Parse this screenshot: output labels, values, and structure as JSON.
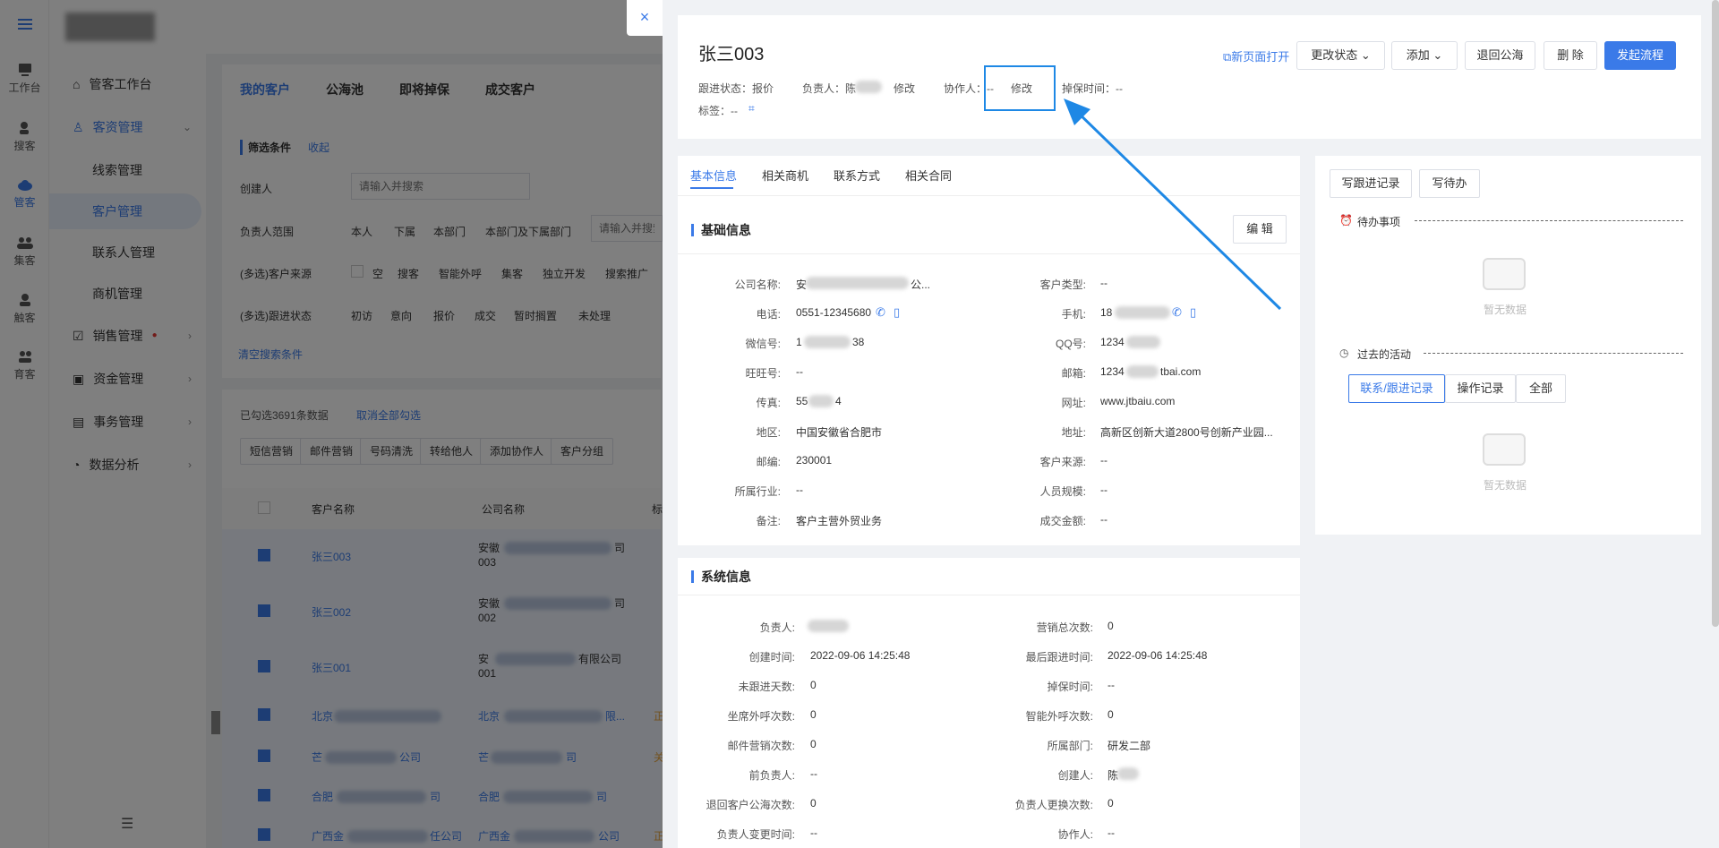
{
  "rail": [
    {
      "label": "工作台",
      "icon": "desk-icon"
    },
    {
      "label": "搜客",
      "icon": "search-user-icon"
    },
    {
      "label": "管客",
      "icon": "cloud-icon"
    },
    {
      "label": "集客",
      "icon": "group-icon"
    },
    {
      "label": "触客",
      "icon": "contact-icon"
    },
    {
      "label": "育客",
      "icon": "nurture-icon"
    }
  ],
  "sidenav": {
    "workbench": "管客工作台",
    "customer_mgmt": "客资管理",
    "leads": "线索管理",
    "customers": "客户管理",
    "contacts": "联系人管理",
    "opportunities": "商机管理",
    "sales": "销售管理",
    "funds": "资金管理",
    "affairs": "事务管理",
    "analytics": "数据分析"
  },
  "main": {
    "tabs": [
      "我的客户",
      "公海池",
      "即将掉保",
      "成交客户"
    ],
    "filter_title": "筛选条件",
    "collapse": "收起",
    "creator_label": "创建人",
    "creator_placeholder": "请输入并搜索",
    "owner_range_label": "负责人范围",
    "owner_range_opts": [
      "本人",
      "下属",
      "本部门",
      "本部门及下属部门"
    ],
    "owner_search_placeholder": "请输入并搜索",
    "source_label": "(多选)客户来源",
    "source_opts": [
      "空",
      "搜客",
      "智能外呼",
      "集客",
      "独立开发",
      "搜索推广"
    ],
    "status_label": "(多选)跟进状态",
    "status_opts": [
      "初访",
      "意向",
      "报价",
      "成交",
      "暂时搁置",
      "未处理"
    ],
    "clear": "清空搜索条件",
    "selected_info": "已勾选3691条数据",
    "cancel_all": "取消全部勾选",
    "actions": [
      "短信营销",
      "邮件营销",
      "号码清洗",
      "转给他人",
      "添加协作人",
      "客户分组"
    ],
    "col_name": "客户名称",
    "col_company": "公司名称",
    "col_extra": "标",
    "rows": [
      {
        "name": "张三003",
        "company_a": "安徽",
        "company_b": "司",
        "company_c": "003"
      },
      {
        "name": "张三002",
        "company_a": "安徽",
        "company_b": "司",
        "company_c": "002"
      },
      {
        "name": "张三001",
        "company_a": "安",
        "company_b": "有限公司",
        "company_c": "001"
      },
      {
        "name": "北京",
        "company_a": "北京",
        "company_b": "限..."
      },
      {
        "name": "芒",
        "company_a": "芒",
        "company_b": "司",
        "name_suffix": "公司"
      },
      {
        "name": "合肥",
        "company_a": "合肥",
        "company_b": "司",
        "name_suffix": "司"
      },
      {
        "name": "广西金",
        "company_a": "广西金",
        "company_b": "公司",
        "name_suffix": "任公司"
      }
    ],
    "row_marks": [
      "正",
      "关",
      "正"
    ]
  },
  "drawer": {
    "close": "×",
    "title": "张三003",
    "follow_status_label": "跟进状态：",
    "follow_status": "报价",
    "owner_label": "负责人：",
    "owner_name": "陈",
    "edit1": "修改",
    "collaborator_label": "协作人：",
    "collaborator_value": "--",
    "edit2": "修改",
    "drop_time_label": "掉保时间：",
    "drop_time": "--",
    "tags_label": "标签：",
    "tags_value": "--",
    "open_new": "新页面打开",
    "btn_change_status": "更改状态",
    "btn_add": "添加",
    "btn_return": "退回公海",
    "btn_delete": "删 除",
    "btn_process": "发起流程",
    "tabs": [
      "基本信息",
      "相关商机",
      "联系方式",
      "相关合同"
    ],
    "basic_title": "基础信息",
    "edit_btn": "编 辑",
    "fields_left": [
      {
        "label": "公司名称:",
        "value": "安",
        "suffix": "公..."
      },
      {
        "label": "电话:",
        "value": "0551-12345680"
      },
      {
        "label": "微信号:",
        "value": "1",
        "suffix": "38"
      },
      {
        "label": "旺旺号:",
        "value": "--"
      },
      {
        "label": "传真:",
        "value": "55",
        "suffix": "4"
      },
      {
        "label": "地区:",
        "value": "中国安徽省合肥市"
      },
      {
        "label": "邮编:",
        "value": "230001"
      },
      {
        "label": "所属行业:",
        "value": "--"
      },
      {
        "label": "备注:",
        "value": "客户主营外贸业务"
      }
    ],
    "fields_right": [
      {
        "label": "客户类型:",
        "value": "--"
      },
      {
        "label": "手机:",
        "value": "18"
      },
      {
        "label": "QQ号:",
        "value": "1234"
      },
      {
        "label": "邮箱:",
        "value": "1234",
        "suffix": "tbai.com"
      },
      {
        "label": "网址:",
        "value": "www.jtbaiu.com"
      },
      {
        "label": "地址:",
        "value": "高新区创新大道2800号创新产业园..."
      },
      {
        "label": "客户来源:",
        "value": "--"
      },
      {
        "label": "人员规模:",
        "value": "--"
      },
      {
        "label": "成交金额:",
        "value": "--"
      }
    ],
    "system_title": "系统信息",
    "sys_left": [
      {
        "label": "负责人:",
        "value": ""
      },
      {
        "label": "创建时间:",
        "value": "2022-09-06 14:25:48"
      },
      {
        "label": "未跟进天数:",
        "value": "0"
      },
      {
        "label": "坐席外呼次数:",
        "value": "0"
      },
      {
        "label": "邮件营销次数:",
        "value": "0"
      },
      {
        "label": "前负责人:",
        "value": "--"
      },
      {
        "label": "退回客户公海次数:",
        "value": "0"
      },
      {
        "label": "负责人变更时间:",
        "value": "--"
      }
    ],
    "sys_right": [
      {
        "label": "营销总次数:",
        "value": "0"
      },
      {
        "label": "最后跟进时间:",
        "value": "2022-09-06 14:25:48"
      },
      {
        "label": "掉保时间:",
        "value": "--"
      },
      {
        "label": "智能外呼次数:",
        "value": "0"
      },
      {
        "label": "所属部门:",
        "value": "研发二部"
      },
      {
        "label": "创建人:",
        "value": "陈"
      },
      {
        "label": "负责人更换次数:",
        "value": "0"
      },
      {
        "label": "协作人:",
        "value": "--"
      }
    ],
    "write_follow": "写跟进记录",
    "write_todo": "写待办",
    "todo_title": "待办事项",
    "no_data": "暂无数据",
    "past_title": "过去的活动",
    "activity_tabs": [
      "联系/跟进记录",
      "操作记录",
      "全部"
    ],
    "no_data2": "暂无数据"
  },
  "colors": {
    "accent": "#3a7ae8",
    "highlight": "#1e88e5",
    "danger": "#e53935"
  }
}
